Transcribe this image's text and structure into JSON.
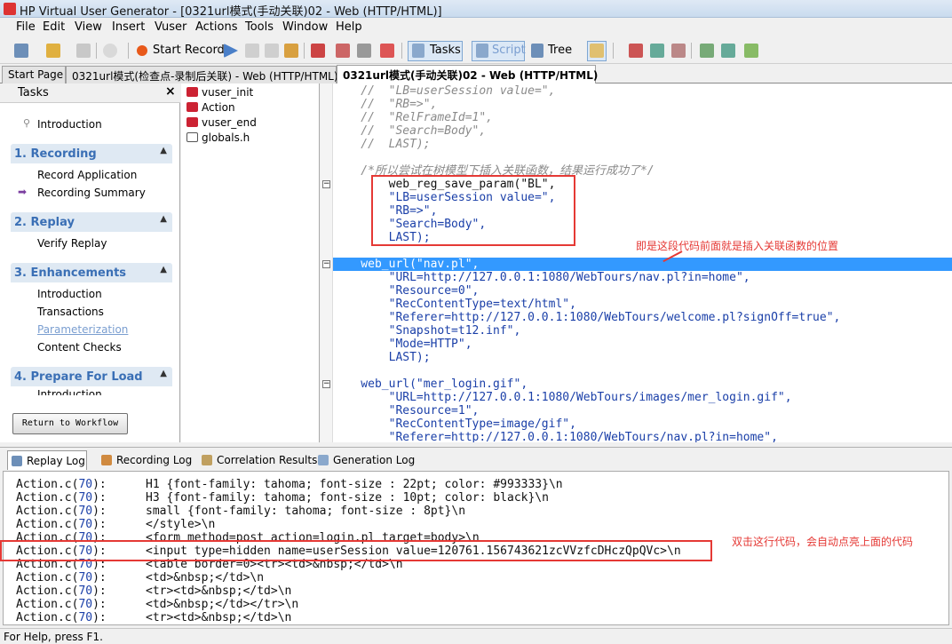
{
  "window": {
    "title": "HP Virtual User Generator - [0321url模式(手动关联)02 - Web (HTTP/HTML)]"
  },
  "menu": [
    "File",
    "Edit",
    "View",
    "Insert",
    "Vuser",
    "Actions",
    "Tools",
    "Window",
    "Help"
  ],
  "toolbar": {
    "start_record": "Start Record",
    "tasks": "Tasks",
    "script": "Script",
    "tree": "Tree"
  },
  "doc_tabs": [
    "Start Page",
    "0321url模式(检查点-录制后关联) - Web (HTTP/HTML)",
    "0321url模式(手动关联)02 - Web (HTTP/HTML)"
  ],
  "tasks": {
    "header": "Tasks",
    "close": "×",
    "intro": "Introduction",
    "groups": [
      {
        "title": "1. Recording",
        "items": [
          "Record Application",
          "Recording Summary"
        ]
      },
      {
        "title": "2. Replay",
        "items": [
          "Verify Replay"
        ]
      },
      {
        "title": "3. Enhancements",
        "items": [
          "Introduction",
          "Transactions",
          "Parameterization",
          "Content Checks"
        ]
      },
      {
        "title": "4. Prepare For Load",
        "items": [
          "Introduction"
        ]
      }
    ],
    "workflow_button": "Return to Workflow"
  },
  "tree": [
    "vuser_init",
    "Action",
    "vuser_end",
    "globals.h"
  ],
  "code": [
    "    //  \"LB=userSession value=\",",
    "    //  \"RB=>\",",
    "    //  \"RelFrameId=1\",",
    "    //  \"Search=Body\",",
    "    //  LAST);",
    "",
    "    /*所以尝试在树模型下插入关联函数，结果运行成功了*/",
    "        web_reg_save_param(\"BL\",",
    "        \"LB=userSession value=\",",
    "        \"RB=>\",",
    "        \"Search=Body\",",
    "        LAST);",
    "",
    "    web_url(\"nav.pl\",",
    "        \"URL=http://127.0.0.1:1080/WebTours/nav.pl?in=home\",",
    "        \"Resource=0\",",
    "        \"RecContentType=text/html\",",
    "        \"Referer=http://127.0.0.1:1080/WebTours/welcome.pl?signOff=true\",",
    "        \"Snapshot=t12.inf\",",
    "        \"Mode=HTTP\",",
    "        LAST);",
    "",
    "    web_url(\"mer_login.gif\",",
    "        \"URL=http://127.0.0.1:1080/WebTours/images/mer_login.gif\",",
    "        \"Resource=1\",",
    "        \"RecContentType=image/gif\",",
    "        \"Referer=http://127.0.0.1:1080/WebTours/nav.pl?in=home\","
  ],
  "annotations": {
    "code_note": "即是这段代码前面就是插入关联函数的位置",
    "log_note": "双击这行代码，会自动点亮上面的代码"
  },
  "log_tabs": [
    "Replay Log",
    "Recording Log",
    "Correlation Results",
    "Generation Log"
  ],
  "log": {
    "prefix": "Action.c(",
    "line_no": "70",
    "suffix": "):",
    "lines": [
      "H1 {font-family: tahoma; font-size : 22pt; color: #993333}\\n",
      "H3 {font-family: tahoma; font-size : 10pt; color: black}\\n",
      "small {font-family: tahoma; font-size : 8pt}\\n",
      "</style>\\n",
      "<form method=post action=login.pl target=body>\\n",
      "<input type=hidden name=userSession value=120761.156743621zcVVzfcDHczQpQVc>\\n",
      "<table border=0><tr><td>&nbsp;</td>\\n",
      "<td>&nbsp;</td>\\n",
      "<tr><td>&nbsp;</td>\\n",
      "<td>&nbsp;</td></tr>\\n",
      "<tr><td>&nbsp;</td>\\n"
    ]
  },
  "status": "For Help, press F1."
}
